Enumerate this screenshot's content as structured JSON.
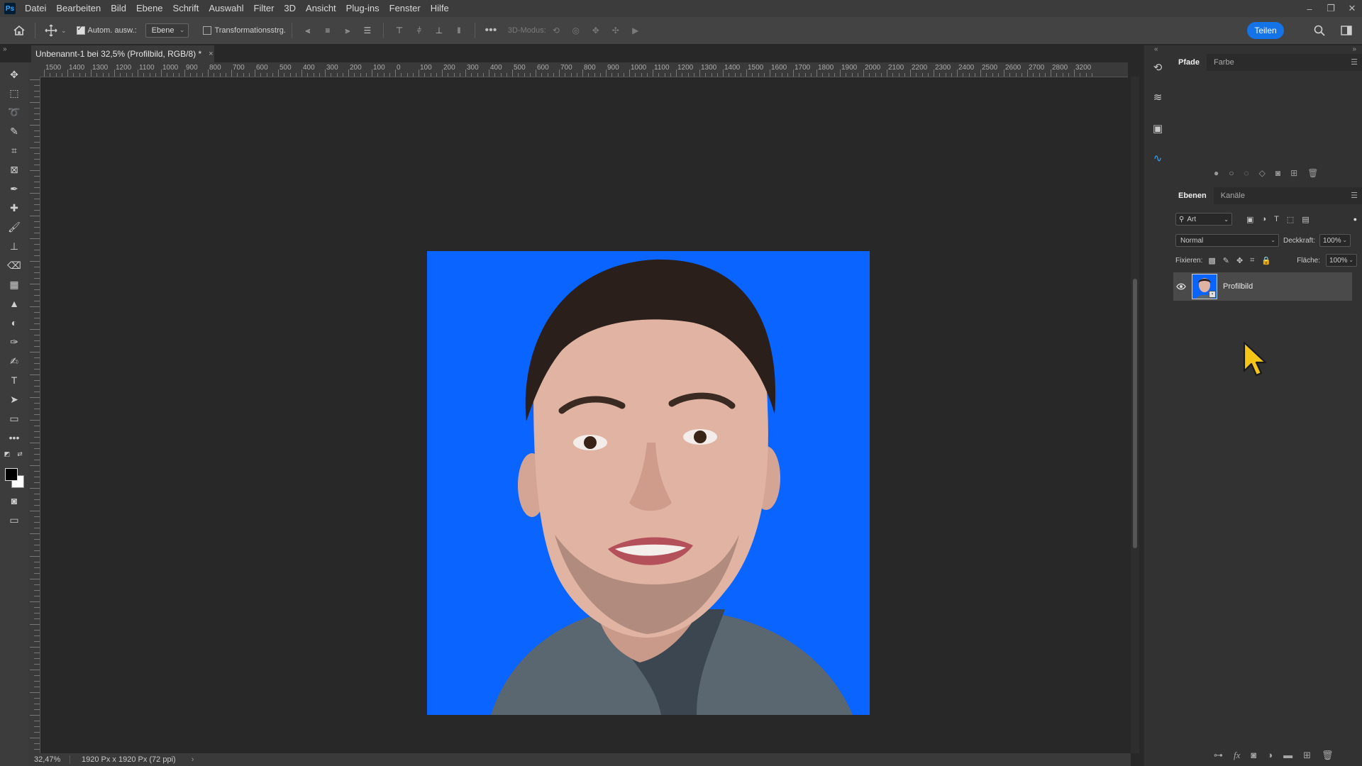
{
  "menu": [
    "Datei",
    "Bearbeiten",
    "Bild",
    "Ebene",
    "Schrift",
    "Auswahl",
    "Filter",
    "3D",
    "Ansicht",
    "Plug-ins",
    "Fenster",
    "Hilfe"
  ],
  "app_logo": "Ps",
  "options": {
    "auto_select_label": "Autom. ausw.:",
    "auto_select_checked": true,
    "auto_select_value": "Ebene",
    "transform_controls_label": "Transformationsstrg.",
    "transform_controls_checked": false,
    "mode_3d_label": "3D-Modus:",
    "share_label": "Teilen"
  },
  "document": {
    "tab_title": "Unbenannt-1 bei 32,5% (Profilbild, RGB/8) *",
    "close_glyph": "×",
    "background_color": "#0a64ff"
  },
  "ruler": {
    "labels": [
      "1500",
      "1400",
      "1300",
      "1200",
      "1100",
      "1000",
      "900",
      "800",
      "700",
      "600",
      "500",
      "400",
      "300",
      "200",
      "100",
      "0",
      "100",
      "200",
      "300",
      "400",
      "500",
      "600",
      "700",
      "800",
      "900",
      "1000",
      "1100",
      "1200",
      "1300",
      "1400",
      "1500",
      "1600",
      "1700",
      "1800",
      "1900",
      "2000",
      "2100",
      "2200",
      "2300",
      "2400",
      "2500",
      "2600",
      "2700",
      "2800",
      "3200"
    ]
  },
  "status": {
    "zoom": "32,47%",
    "doc_info": "1920 Px x 1920 Px (72 ppi)"
  },
  "paths_panel": {
    "tabs": [
      "Pfade",
      "Farbe"
    ],
    "active_tab": "Pfade"
  },
  "layers_panel": {
    "tabs": [
      "Ebenen",
      "Kanäle"
    ],
    "active_tab": "Ebenen",
    "kind_filter": "Art",
    "blend_mode": "Normal",
    "opacity_label": "Deckkraft:",
    "opacity_value": "100%",
    "lock_label": "Fixieren:",
    "fill_label": "Fläche:",
    "fill_value": "100%",
    "layers": [
      {
        "name": "Profilbild",
        "visible": true,
        "selected": true
      }
    ]
  },
  "colors": {
    "accent": "#1473e6",
    "foreground": "#000000",
    "background": "#ffffff",
    "cursor": "#f5c518"
  }
}
